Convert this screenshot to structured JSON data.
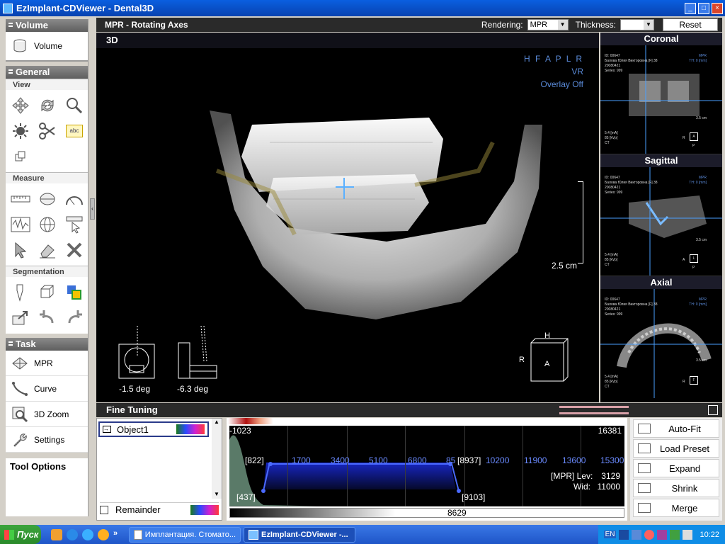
{
  "window": {
    "title": "EzImplant-CDViewer - Dental3D"
  },
  "left": {
    "volume": {
      "header": "Volume",
      "button": "Volume"
    },
    "general": {
      "header": "General",
      "view_label": "View",
      "measure_label": "Measure",
      "segmentation_label": "Segmentation",
      "abc_label": "abc"
    },
    "task": {
      "header": "Task",
      "items": [
        "MPR",
        "Curve",
        "3D Zoom",
        "Settings"
      ]
    },
    "tool_options": "Tool Options"
  },
  "mpr": {
    "title": "MPR - Rotating Axes",
    "rendering_label": "Rendering:",
    "rendering_value": "MPR",
    "thickness_label": "Thickness:",
    "thickness_value": "",
    "reset": "Reset"
  },
  "view3d": {
    "label": "3D",
    "orient": "H F A P L R",
    "mode": "VR",
    "overlay": "Overlay Off",
    "scale": "2.5 cm",
    "rot1": "-1.5 deg",
    "rot2": "-6.3 deg",
    "cube_h": "H",
    "cube_r": "R",
    "cube_a": "A"
  },
  "mini_views": [
    {
      "title": "Coronal",
      "tag": "MPR",
      "info": [
        "ID: 00647",
        "Балова Юлия Викторовна [F] 38",
        "20080421",
        "Series: 999"
      ],
      "th": "TH: 0 [mm]",
      "scale": "3.5 cm",
      "ma": "5.4 [mA]",
      "kvp": "85 [kVp]",
      "ct": "CT",
      "left": "R",
      "box": "A",
      "below": "P"
    },
    {
      "title": "Sagittal",
      "tag": "MPR",
      "info": [
        "ID: 00647",
        "Балова Юлия Викторовна [F] 38",
        "20080421",
        "Series: 999"
      ],
      "th": "TH: 0 [mm]",
      "scale": "3.5 cm",
      "ma": "5.4 [mA]",
      "kvp": "85 [kVp]",
      "ct": "CT",
      "left": "A",
      "box": "L",
      "below": "P"
    },
    {
      "title": "Axial",
      "tag": "MPR",
      "info": [
        "ID: 00647",
        "Балова Юлия Викторовна [F] 38",
        "20080421",
        "Series: 999"
      ],
      "th": "TH: 0 [mm]",
      "scale": "3.5 cm",
      "ma": "5.4 [mA]",
      "kvp": "85 [kVp]",
      "ct": "CT",
      "left": "R",
      "box": "F",
      "below": ""
    }
  ],
  "fine_tuning": {
    "title": "Fine Tuning",
    "object": "Object1",
    "remainder": "Remainder",
    "hist_min": "-1023",
    "hist_max": "16381",
    "ticks": [
      "1700",
      "3400",
      "5100",
      "6800",
      "85",
      "10200",
      "11900",
      "13600",
      "15300"
    ],
    "p1": "[822]",
    "p2": "[8937]",
    "p3": "[437]",
    "p4": "[9103]",
    "lev_label": "[MPR] Lev:",
    "lev": "3129",
    "wid_label": "Wid:",
    "wid": "11000",
    "bottom_value": "8629",
    "buttons": [
      "Auto-Fit",
      "Load Preset",
      "Expand",
      "Shrink",
      "Merge"
    ]
  },
  "taskbar": {
    "start": "Пуск",
    "items": [
      "Имплантация. Стомато...",
      "EzImplant-CDViewer -..."
    ],
    "lang": "EN",
    "time": "10:22"
  }
}
